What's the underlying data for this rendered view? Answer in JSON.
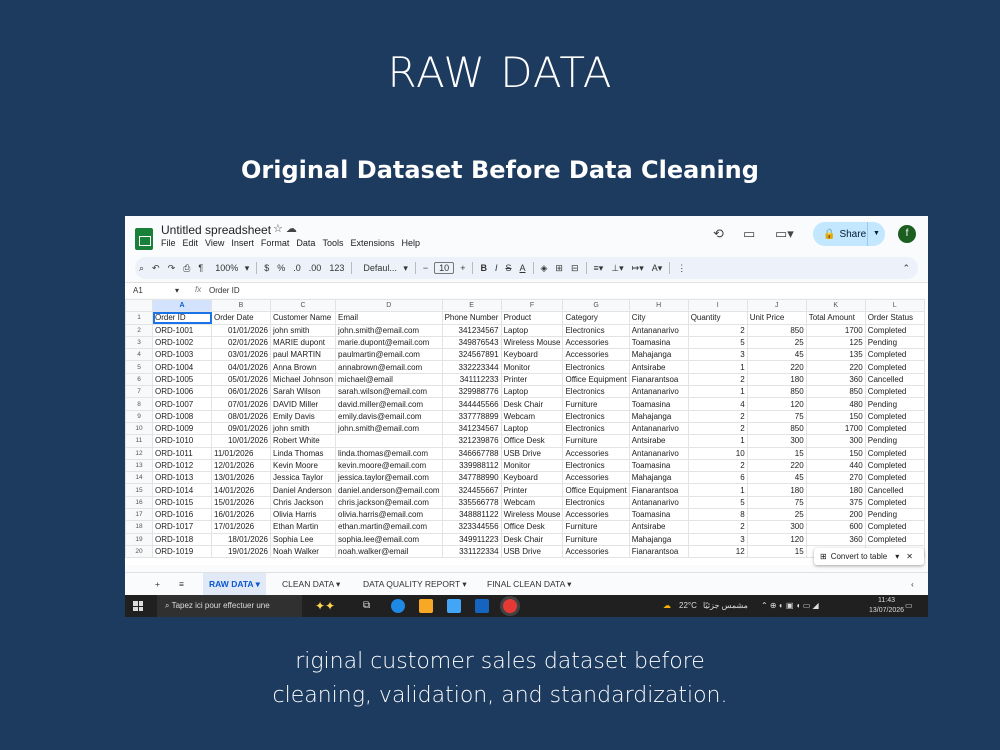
{
  "slide": {
    "title": "RAW DATA",
    "subtitle": "Original Dataset Before Data Cleaning",
    "caption_line1": "riginal customer sales dataset before",
    "caption_line2": "cleaning, validation, and standardization."
  },
  "app": {
    "doc_title": "Untitled spreadsheet",
    "menu": [
      "File",
      "Edit",
      "View",
      "Insert",
      "Format",
      "Data",
      "Tools",
      "Extensions",
      "Help"
    ],
    "share_label": "Share",
    "avatar_letter": "f",
    "zoom": "100%",
    "currency": "$",
    "percent": "%",
    "dec_less": ".0",
    "dec_more": ".00",
    "num_format": "123",
    "font_name": "Defaul...",
    "font_size": "10",
    "cell_ref": "A1",
    "formula_value": "Order ID",
    "toast_label": "Convert to table",
    "accent": "#0b57d0"
  },
  "sheet": {
    "columns": [
      "A",
      "B",
      "C",
      "D",
      "E",
      "F",
      "G",
      "H",
      "I",
      "J",
      "K",
      "L"
    ],
    "header": [
      "Order ID",
      "Order Date",
      "Customer Name",
      "Email",
      "Phone Number",
      "Product",
      "Category",
      "City",
      "Quantity",
      "Unit Price",
      "Total Amount",
      "Order Status"
    ],
    "rows": [
      [
        "ORD-1001",
        "01/01/2026",
        "john smith",
        "john.smith@email.com",
        "341234567",
        "Laptop",
        "Electronics",
        "Antananarivo",
        "2",
        "850",
        "1700",
        "Completed"
      ],
      [
        "ORD-1002",
        "02/01/2026",
        "MARIE dupont",
        "marie.dupont@email.com",
        "349876543",
        "Wireless Mouse",
        "Accessories",
        "Toamasina",
        "5",
        "25",
        "125",
        "Pending"
      ],
      [
        "ORD-1003",
        "03/01/2026",
        "paul MARTIN",
        "paulmartin@email.com",
        "324567891",
        "Keyboard",
        "Accessories",
        "Mahajanga",
        "3",
        "45",
        "135",
        "Completed"
      ],
      [
        "ORD-1004",
        "04/01/2026",
        "Anna Brown",
        "annabrown@email.com",
        "332223344",
        "Monitor",
        "Electronics",
        "Antsirabe",
        "1",
        "220",
        "220",
        "Completed"
      ],
      [
        "ORD-1005",
        "05/01/2026",
        "Michael Johnson",
        "michael@email",
        "341112233",
        "Printer",
        "Office Equipment",
        "Fianarantsoa",
        "2",
        "180",
        "360",
        "Cancelled"
      ],
      [
        "ORD-1006",
        "06/01/2026",
        "Sarah Wilson",
        "sarah.wilson@email.com",
        "329988776",
        "Laptop",
        "Electronics",
        "Antananarivo",
        "1",
        "850",
        "850",
        "Completed"
      ],
      [
        "ORD-1007",
        "07/01/2026",
        "DAVID Miller",
        "david.miller@email.com",
        "344445566",
        "Desk Chair",
        "Furniture",
        "Toamasina",
        "4",
        "120",
        "480",
        "Pending"
      ],
      [
        "ORD-1008",
        "08/01/2026",
        "Emily Davis",
        "emily.davis@email.com",
        "337778899",
        "Webcam",
        "Electronics",
        "Mahajanga",
        "2",
        "75",
        "150",
        "Completed"
      ],
      [
        "ORD-1009",
        "09/01/2026",
        "john smith",
        "john.smith@email.com",
        "341234567",
        "Laptop",
        "Electronics",
        "Antananarivo",
        "2",
        "850",
        "1700",
        "Completed"
      ],
      [
        "ORD-1010",
        "10/01/2026",
        "Robert White",
        "",
        "321239876",
        "Office Desk",
        "Furniture",
        "Antsirabe",
        "1",
        "300",
        "300",
        "Pending"
      ],
      [
        "ORD-1011",
        "11/01/2026",
        "Linda Thomas",
        "linda.thomas@email.com",
        "346667788",
        "USB Drive",
        "Accessories",
        "Antananarivo",
        "10",
        "15",
        "150",
        "Completed"
      ],
      [
        "ORD-1012",
        "12/01/2026",
        "Kevin Moore",
        "kevin.moore@email.com",
        "339988112",
        "Monitor",
        "Electronics",
        "Toamasina",
        "2",
        "220",
        "440",
        "Completed"
      ],
      [
        "ORD-1013",
        "13/01/2026",
        "Jessica Taylor",
        "jessica.taylor@email.com",
        "347788990",
        "Keyboard",
        "Accessories",
        "Mahajanga",
        "6",
        "45",
        "270",
        "Completed"
      ],
      [
        "ORD-1014",
        "14/01/2026",
        "Daniel Anderson",
        "daniel.anderson@email.com",
        "324455667",
        "Printer",
        "Office Equipment",
        "Fianarantsoa",
        "1",
        "180",
        "180",
        "Cancelled"
      ],
      [
        "ORD-1015",
        "15/01/2026",
        "Chris Jackson",
        "chris.jackson@email.com",
        "335566778",
        "Webcam",
        "Electronics",
        "Antananarivo",
        "5",
        "75",
        "375",
        "Completed"
      ],
      [
        "ORD-1016",
        "16/01/2026",
        "Olivia Harris",
        "olivia.harris@email.com",
        "348881122",
        "Wireless Mouse",
        "Accessories",
        "Toamasina",
        "8",
        "25",
        "200",
        "Pending"
      ],
      [
        "ORD-1017",
        "17/01/2026",
        "Ethan Martin",
        "ethan.martin@email.com",
        "323344556",
        "Office Desk",
        "Furniture",
        "Antsirabe",
        "2",
        "300",
        "600",
        "Completed"
      ],
      [
        "ORD-1018",
        "18/01/2026",
        "Sophia Lee",
        "sophia.lee@email.com",
        "349911223",
        "Desk Chair",
        "Furniture",
        "Mahajanga",
        "3",
        "120",
        "360",
        "Completed"
      ],
      [
        "ORD-1019",
        "19/01/2026",
        "Noah Walker",
        "noah.walker@email",
        "331122334",
        "USB Drive",
        "Accessories",
        "Fianarantsoa",
        "12",
        "15",
        "",
        ""
      ]
    ],
    "date_left_rows": [
      12,
      13,
      14,
      15,
      16,
      17,
      18
    ]
  },
  "tabs": [
    "RAW DATA",
    "CLEAN DATA",
    "DATA QUALITY  REPORT",
    "FINAL CLEAN DATA"
  ],
  "taskbar": {
    "search_placeholder": "Tapez ici pour effectuer une",
    "weather": "22°C",
    "weather_text": "مشمس جزئيًا",
    "time": "11:43",
    "date": "13/07/2026"
  }
}
